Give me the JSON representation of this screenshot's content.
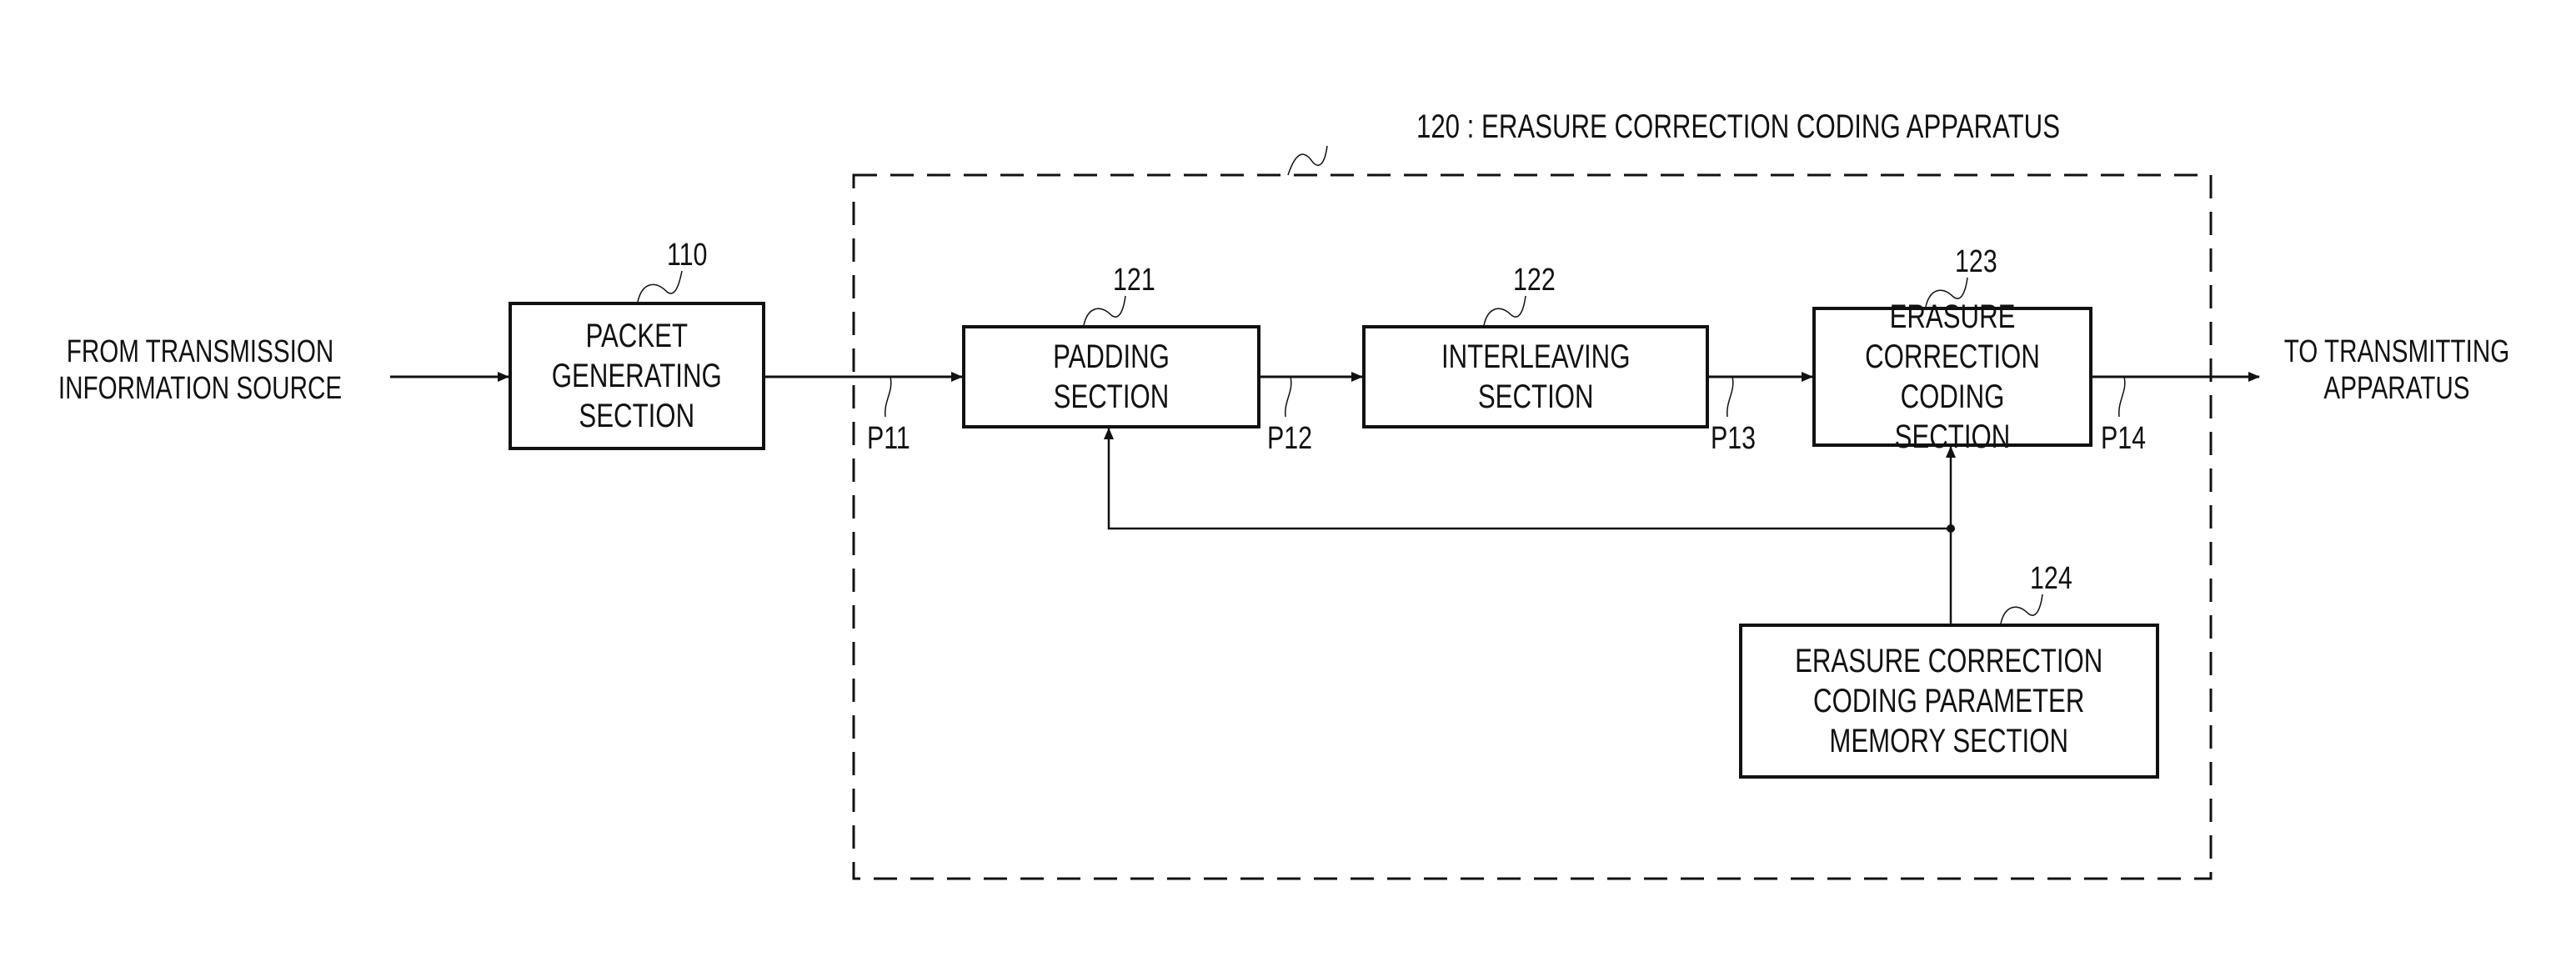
{
  "figure": {
    "apparatus_label": "120 : ERASURE CORRECTION CODING APPARATUS",
    "input_label": "FROM TRANSMISSION\nINFORMATION SOURCE",
    "output_label": "TO TRANSMITTING\nAPPARATUS",
    "blocks": [
      {
        "id": "packet",
        "ref": "110",
        "text": "PACKET\nGENERATING\nSECTION"
      },
      {
        "id": "padding",
        "ref": "121",
        "text": "PADDING SECTION"
      },
      {
        "id": "interleaving",
        "ref": "122",
        "text": "INTERLEAVING\nSECTION"
      },
      {
        "id": "ecc",
        "ref": "123",
        "text": "ERASURE\nCORRECTION\nCODING SECTION"
      },
      {
        "id": "memory",
        "ref": "124",
        "text": "ERASURE CORRECTION\nCODING PARAMETER\nMEMORY SECTION"
      }
    ],
    "signals": [
      "P11",
      "P12",
      "P13",
      "P14"
    ]
  }
}
